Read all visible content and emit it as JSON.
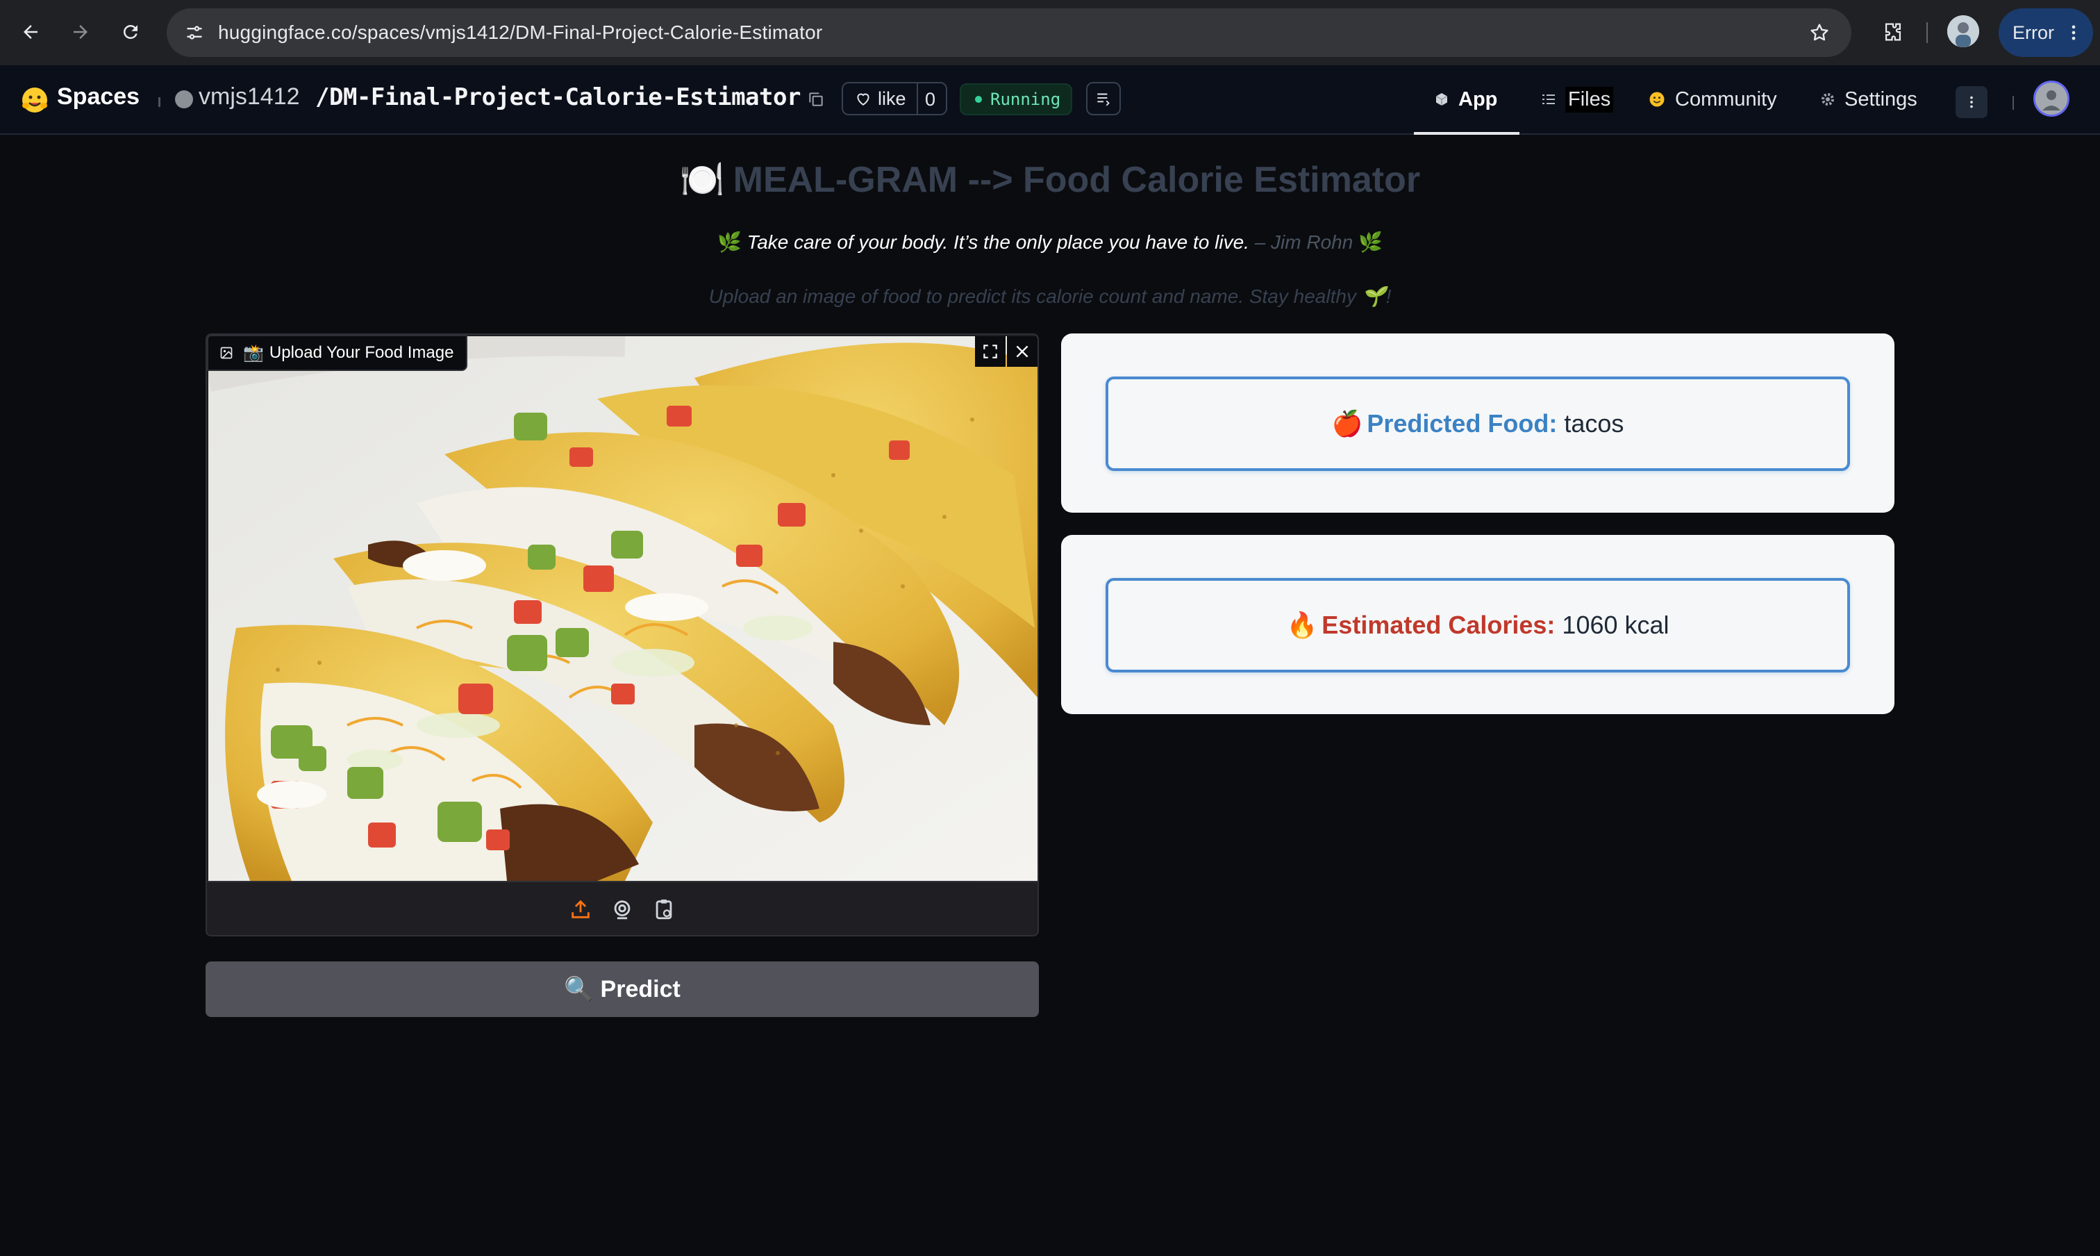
{
  "browser": {
    "url": "huggingface.co/spaces/vmjs1412/DM-Final-Project-Calorie-Estimator",
    "error_label": "Error"
  },
  "header": {
    "spaces_label": "Spaces",
    "owner": "vmjs1412",
    "repo": "/DM-Final-Project-Calorie-Estimator",
    "like_label": "like",
    "like_count": "0",
    "status": "Running",
    "tabs": [
      {
        "label": "App",
        "icon": "cube-icon",
        "active": true
      },
      {
        "label": "Files",
        "icon": "files-icon"
      },
      {
        "label": "Community",
        "icon": "community-icon"
      },
      {
        "label": "Settings",
        "icon": "gear-icon"
      }
    ]
  },
  "app": {
    "title_emoji": "🍽️",
    "title": "MEAL-GRAM --> Food Calorie Estimator",
    "quote_leaf": "🌿",
    "quote_text": "Take care of your body. It’s the only place you have to live.",
    "quote_author": "– Jim Rohn",
    "subtitle": "Upload an image of food to predict its calorie count and name. Stay healthy 🌱!",
    "upload_label_emoji": "📸",
    "upload_label": "Upload Your Food Image",
    "predict_emoji": "🔍",
    "predict_label": "Predict",
    "food_emoji": "🍎",
    "food_key": "Predicted Food:",
    "food_value": "tacos",
    "calorie_emoji": "🔥",
    "calorie_key": "Estimated Calories:",
    "calorie_value": "1060 kcal"
  },
  "colors": {
    "accent_blue": "#4a8ad0",
    "calorie_red": "#c0392b",
    "running_green": "#34d399",
    "upload_orange": "#f97316"
  }
}
